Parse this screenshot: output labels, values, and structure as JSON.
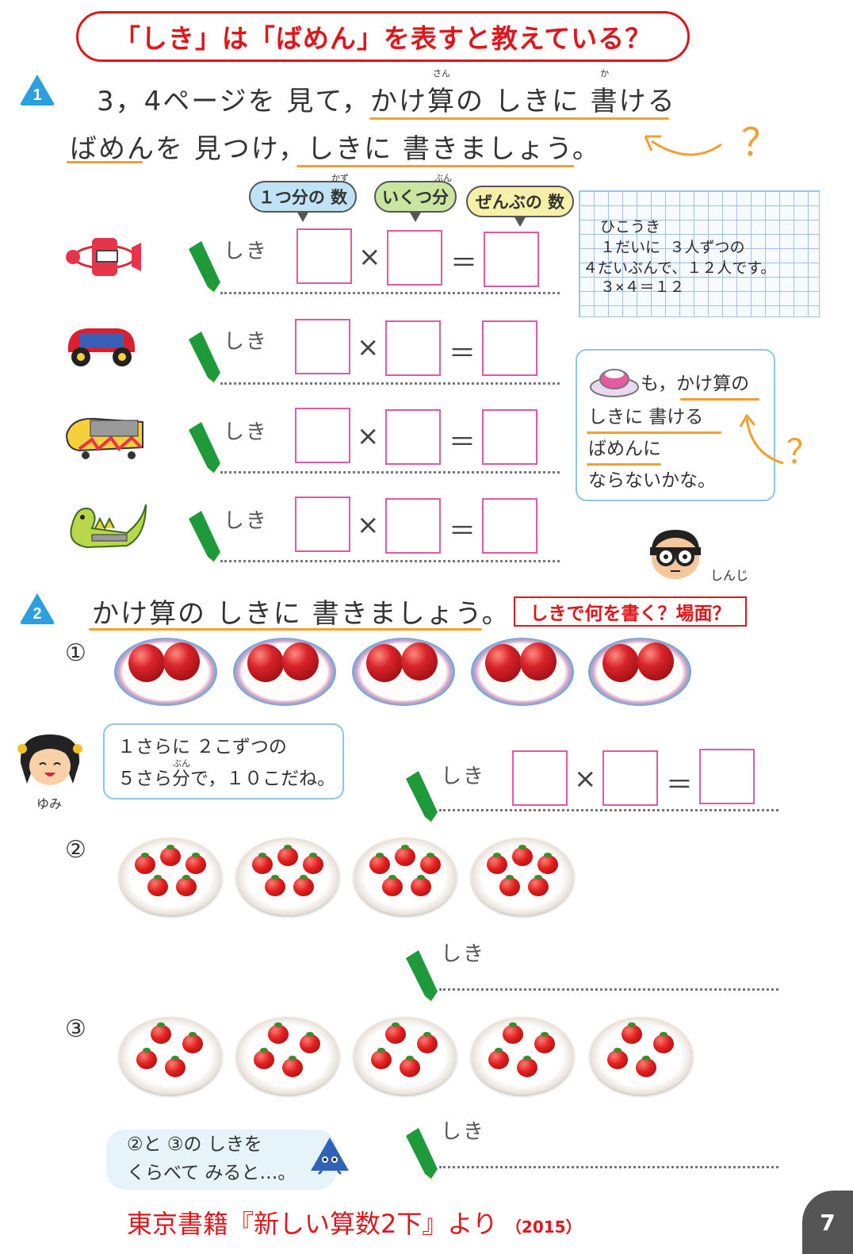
{
  "header": {
    "title": "「しき」は「ばめん」を表すと教えている？"
  },
  "q1": {
    "number": "1",
    "line1": {
      "a": "3，4ページを 見て，",
      "kake": "かけ",
      "san": "算",
      "san_ruby": "さん",
      "no": "の しきに ",
      "kaku": "書",
      "kaku_ruby": "か",
      "keru": "ける"
    },
    "line2": "ばめんを 見つけ，しきに 書きましょう。",
    "question_mark": "？",
    "labels": [
      {
        "text": "１つ分の 数",
        "ruby": "かず",
        "color": "#bfe3f5"
      },
      {
        "text": "いくつ分",
        "ruby": "ぶん",
        "color": "#c8e6a0"
      },
      {
        "text": "ぜんぶの 数",
        "ruby": "",
        "color": "#f6f0a8"
      }
    ],
    "rows": [
      {
        "icon": "airplane",
        "shiki": "しき",
        "times": "×",
        "equals": "＝"
      },
      {
        "icon": "car",
        "shiki": "しき",
        "times": "×",
        "equals": "＝"
      },
      {
        "icon": "coaster",
        "shiki": "しき",
        "times": "×",
        "equals": "＝"
      },
      {
        "icon": "dragon",
        "shiki": "しき",
        "times": "×",
        "equals": "＝"
      }
    ],
    "notebook": {
      "line1": "ひこうき",
      "line2": " １だいに ３人ずつの",
      "line3": "４だいぶんで、１２人です。",
      "line4": " ３×４＝１２"
    },
    "bubble": {
      "line1": "も，かけ算の",
      "line2": "しきに 書ける",
      "line3": "ばめんに",
      "line4": "ならないかな。"
    },
    "bubble_qmark": "？",
    "shinji_name": "しんじ"
  },
  "q2": {
    "number": "2",
    "instruction": "かけ算の しきに 書きましょう。",
    "red_label": "しきで何を書く？場面？",
    "items": [
      {
        "num": "①",
        "plates": 5,
        "per_plate": 2,
        "kind": "apple"
      },
      {
        "num": "②",
        "plates": 4,
        "per_plate": 5,
        "kind": "tomato"
      },
      {
        "num": "③",
        "plates": 5,
        "per_plate": 4,
        "kind": "tomato"
      }
    ],
    "yumi_bubble": {
      "line1": "１さらに ２こずつの",
      "line2": "５さら分で，１０こだね。",
      "ruby": "ぶん"
    },
    "yumi_name": "ゆみ",
    "shiki": "しき",
    "times": "×",
    "equals": "＝",
    "compare_bubble": {
      "line1": "②と ③の しきを",
      "line2": "くらべて みると…。"
    }
  },
  "footer": {
    "credit": "東京書籍『新しい算数2下』より",
    "year": "（2015）",
    "page": "7"
  }
}
